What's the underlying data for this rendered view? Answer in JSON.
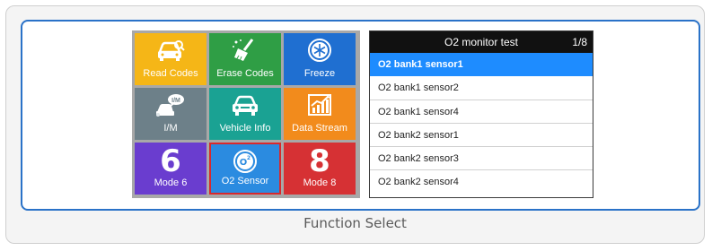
{
  "caption": "Function Select",
  "grid": {
    "tiles": [
      {
        "label": "Read Codes",
        "icon": "car-search-icon"
      },
      {
        "label": "Erase Codes",
        "icon": "broom-icon"
      },
      {
        "label": "Freeze",
        "icon": "snowflake-icon"
      },
      {
        "label": "I/M",
        "icon": "im-readiness-icon"
      },
      {
        "label": "Vehicle Info",
        "icon": "car-icon"
      },
      {
        "label": "Data Stream",
        "icon": "chart-up-icon"
      },
      {
        "label": "Mode 6",
        "big": "6"
      },
      {
        "label": "O2 Sensor",
        "icon": "o2-sensor-icon",
        "selected": true
      },
      {
        "label": "Mode 8",
        "big": "8"
      }
    ]
  },
  "list": {
    "title": "O2 monitor test",
    "page": "1/8",
    "items": [
      "O2 bank1 sensor1",
      "O2 bank1 sensor2",
      "O2 bank1 sensor4",
      "O2 bank2 sensor1",
      "O2 bank2 sensor3",
      "O2 bank2 sensor4"
    ],
    "selected_index": 0
  },
  "colors": {
    "frame_blue": "#2a72c8",
    "selected_row": "#1e8cff",
    "selected_tile_border": "#d9282c"
  }
}
